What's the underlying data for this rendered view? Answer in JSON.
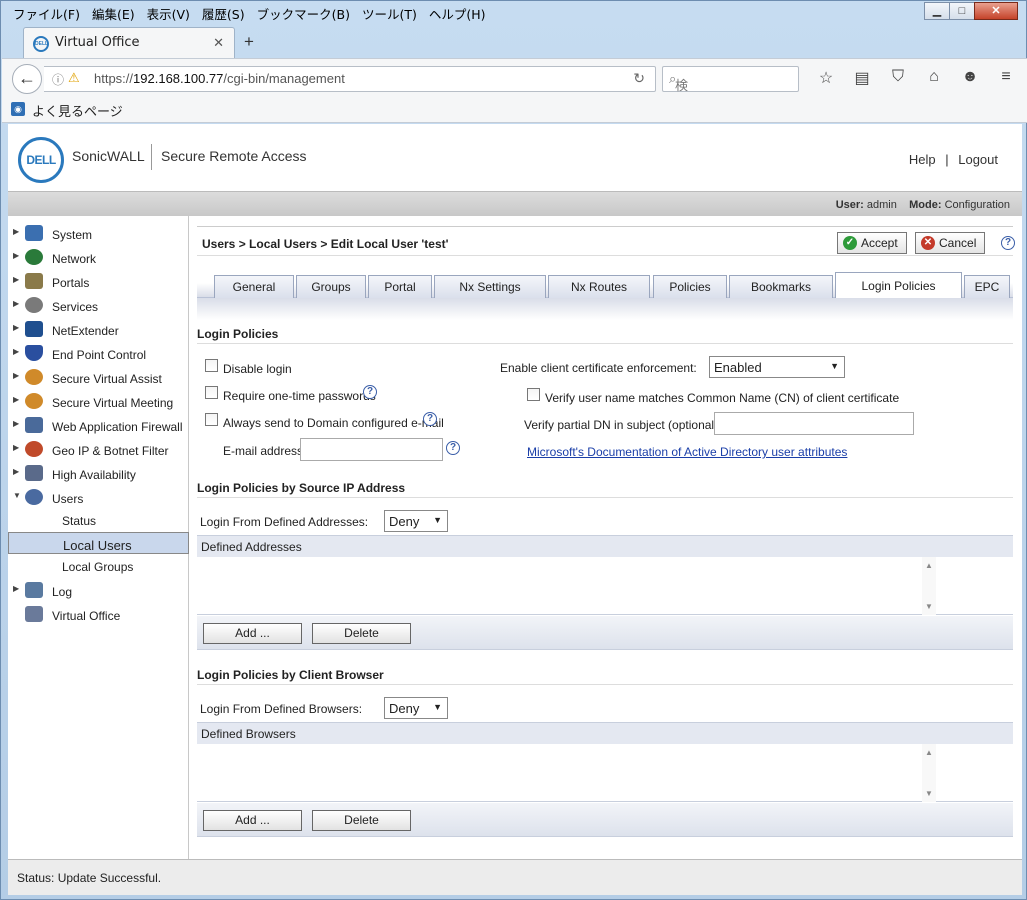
{
  "browser": {
    "menu": [
      "ファイル(F)",
      "編集(E)",
      "表示(V)",
      "履歴(S)",
      "ブックマーク(B)",
      "ツール(T)",
      "ヘルプ(H)"
    ],
    "tab_title": "Virtual Office",
    "url_prefix": "https://",
    "url_host": "192.168.100.77",
    "url_path": "/cgi-bin/management",
    "search_placeholder": "検索",
    "bookmark_label": "よく見るページ",
    "window_controls": {
      "minimize": "▁",
      "maximize": "□",
      "close": "✕"
    }
  },
  "header": {
    "logo_text": "DELL",
    "brand": "SonicWALL",
    "product": "Secure Remote Access",
    "help": "Help",
    "separator": "|",
    "logout": "Logout"
  },
  "userbar": {
    "user_label": "User:",
    "user_value": "admin",
    "mode_label": "Mode:",
    "mode_value": "Configuration"
  },
  "sidebar": {
    "items": [
      {
        "label": "System",
        "icon": "monitor-icon",
        "color": "#3b6fb0"
      },
      {
        "label": "Network",
        "icon": "globe-icon",
        "color": "#2a7a3a"
      },
      {
        "label": "Portals",
        "icon": "house-icon",
        "color": "#8a7a4a"
      },
      {
        "label": "Services",
        "icon": "gears-icon",
        "color": "#7a7a7a"
      },
      {
        "label": "NetExtender",
        "icon": "netextender-icon",
        "color": "#1f4f8f"
      },
      {
        "label": "End Point Control",
        "icon": "shield-icon",
        "color": "#2a4f9f"
      },
      {
        "label": "Secure Virtual Assist",
        "icon": "person-assist-icon",
        "color": "#d08a2a"
      },
      {
        "label": "Secure Virtual Meeting",
        "icon": "meeting-icon",
        "color": "#d08a2a"
      },
      {
        "label": "Web Application Firewall",
        "icon": "firewall-icon",
        "color": "#4a6a9a"
      },
      {
        "label": "Geo IP & Botnet Filter",
        "icon": "geoip-icon",
        "color": "#c04a2a"
      },
      {
        "label": "High Availability",
        "icon": "servers-icon",
        "color": "#5a6a8a"
      },
      {
        "label": "Users",
        "icon": "users-icon",
        "color": "#4a6aa0"
      }
    ],
    "users_sub": [
      "Status",
      "Local Users",
      "Local Groups"
    ],
    "after": [
      {
        "label": "Log",
        "icon": "log-icon",
        "color": "#5a7aa0"
      },
      {
        "label": "Virtual Office",
        "icon": "building-icon",
        "color": "#6a7a9a"
      }
    ]
  },
  "content": {
    "breadcrumb": "Users > Local Users > Edit Local User 'test'",
    "accept": "Accept",
    "cancel": "Cancel",
    "tabs": [
      "General",
      "Groups",
      "Portal",
      "Nx Settings",
      "Nx Routes",
      "Policies",
      "Bookmarks",
      "Login Policies",
      "EPC"
    ],
    "active_tab": "Login Policies",
    "login_policies": {
      "title": "Login Policies",
      "disable_login": "Disable login",
      "require_otp": "Require one-time passwords",
      "always_send": "Always send to Domain configured e-mail",
      "email_label": "E-mail address:",
      "email_value": "",
      "cert_label": "Enable client certificate enforcement:",
      "cert_value": "Enabled",
      "verify_cn": "Verify user name matches Common Name (CN) of client certificate",
      "verify_dn_label": "Verify partial DN in subject (optional):",
      "verify_dn_value": "",
      "ms_link": "Microsoft's Documentation of Active Directory user attributes"
    },
    "by_source_ip": {
      "title": "Login Policies by Source IP Address",
      "from_label": "Login From Defined Addresses:",
      "from_value": "Deny",
      "grid_header": "Defined Addresses",
      "add": "Add ...",
      "delete": "Delete"
    },
    "by_browser": {
      "title": "Login Policies by Client Browser",
      "from_label": "Login From Defined Browsers:",
      "from_value": "Deny",
      "grid_header": "Defined Browsers",
      "add": "Add ...",
      "delete": "Delete"
    }
  },
  "status": "Status: Update Successful."
}
